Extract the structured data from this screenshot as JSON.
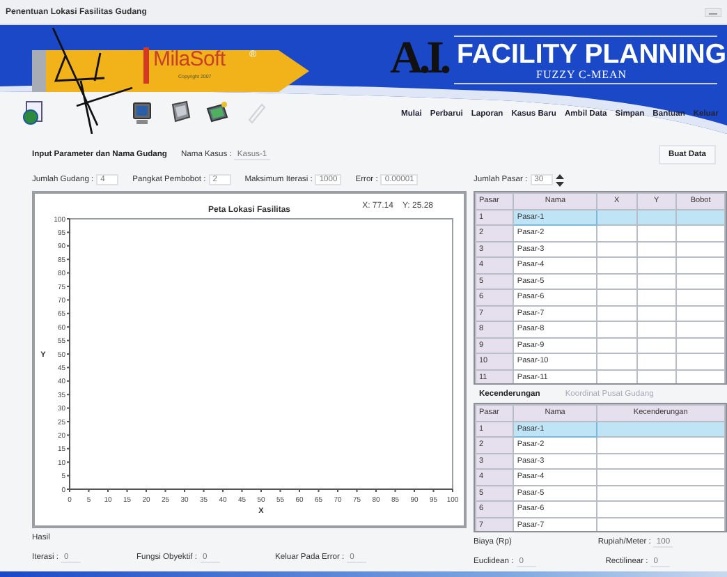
{
  "window": {
    "title": "Penentuan Lokasi Fasilitas Gudang"
  },
  "banner": {
    "brand": "MilaSoft",
    "brand_mark": "®",
    "copyright": "Copyright 2007",
    "logo": "A.I.",
    "title": "FACILITY PLANNING",
    "subtitle": "FUZZY C-MEAN"
  },
  "toolbar": [
    {
      "kind": "globe",
      "disabled": false
    },
    {
      "kind": "computer",
      "disabled": false
    },
    {
      "kind": "monitor",
      "disabled": false
    },
    {
      "kind": "tablet",
      "disabled": false
    },
    {
      "kind": "pen",
      "disabled": true
    }
  ],
  "menu": [
    "Mulai",
    "Perbarui",
    "Laporan",
    "Kasus Baru",
    "Ambil Data",
    "Simpan",
    "Bantuan",
    "Keluar"
  ],
  "params": {
    "heading": "Input Parameter dan Nama Gudang",
    "case_label": "Nama Kasus :",
    "case_value": "Kasus-1",
    "fields": [
      {
        "label": "Jumlah Gudang :",
        "value": "4"
      },
      {
        "label": "Pangkat Pembobot :",
        "value": "2"
      },
      {
        "label": "Maksimum Iterasi :",
        "value": "1000"
      },
      {
        "label": "Error :",
        "value": "0.00001"
      }
    ],
    "market_count": {
      "label": "Jumlah Pasar :",
      "value": "30"
    },
    "create_button": "Buat Data"
  },
  "chart": {
    "coords": "X: 77.14    Y: 25.28",
    "chart_data": {
      "type": "scatter",
      "title": "Peta Lokasi Fasilitas",
      "xlabel": "X",
      "ylabel": "Y",
      "xlim": [
        0,
        100
      ],
      "ylim": [
        0,
        100
      ],
      "xticks": [
        0,
        5,
        10,
        15,
        20,
        25,
        30,
        35,
        40,
        45,
        50,
        55,
        60,
        65,
        70,
        75,
        80,
        85,
        90,
        95,
        100
      ],
      "yticks": [
        0,
        5,
        10,
        15,
        20,
        25,
        30,
        35,
        40,
        45,
        50,
        55,
        60,
        65,
        70,
        75,
        80,
        85,
        90,
        95,
        100
      ]
    }
  },
  "markets_table": {
    "columns": [
      "Pasar",
      "Nama",
      "X",
      "Y",
      "Bobot"
    ],
    "rows": [
      {
        "no": "1",
        "name": "Pasar-1",
        "selected": true
      },
      {
        "no": "2",
        "name": "Pasar-2",
        "selected": false
      },
      {
        "no": "3",
        "name": "Pasar-3",
        "selected": false
      },
      {
        "no": "4",
        "name": "Pasar-4",
        "selected": false
      },
      {
        "no": "5",
        "name": "Pasar-5",
        "selected": false
      },
      {
        "no": "6",
        "name": "Pasar-6",
        "selected": false
      },
      {
        "no": "7",
        "name": "Pasar-7",
        "selected": false
      },
      {
        "no": "8",
        "name": "Pasar-8",
        "selected": false
      },
      {
        "no": "9",
        "name": "Pasar-9",
        "selected": false
      },
      {
        "no": "10",
        "name": "Pasar-10",
        "selected": false
      },
      {
        "no": "11",
        "name": "Pasar-11",
        "selected": false
      }
    ]
  },
  "tendency": {
    "tabs": [
      {
        "label": "Kecenderungan",
        "selected": true
      },
      {
        "label": "Koordinat Pusat Gudang",
        "selected": false
      }
    ],
    "columns": [
      "Pasar",
      "Nama",
      "Kecenderungan"
    ],
    "rows": [
      {
        "no": "1",
        "name": "Pasar-1",
        "selected": true
      },
      {
        "no": "2",
        "name": "Pasar-2",
        "selected": false
      },
      {
        "no": "3",
        "name": "Pasar-3",
        "selected": false
      },
      {
        "no": "4",
        "name": "Pasar-4",
        "selected": false
      },
      {
        "no": "5",
        "name": "Pasar-5",
        "selected": false
      },
      {
        "no": "6",
        "name": "Pasar-6",
        "selected": false
      },
      {
        "no": "7",
        "name": "Pasar-7",
        "selected": false
      }
    ]
  },
  "results": {
    "heading": "Hasil",
    "items": [
      {
        "label": "Iterasi :",
        "value": "0"
      },
      {
        "label": "Fungsi Obyektif :",
        "value": "0"
      },
      {
        "label": "Keluar Pada Error :",
        "value": "0"
      }
    ]
  },
  "cost": {
    "heading": "Biaya (Rp)",
    "rate": {
      "label": "Rupiah/Meter :",
      "value": "100"
    },
    "items": [
      {
        "label": "Euclidean :",
        "value": "0"
      },
      {
        "label": "Rectilinear :",
        "value": "0"
      }
    ]
  }
}
